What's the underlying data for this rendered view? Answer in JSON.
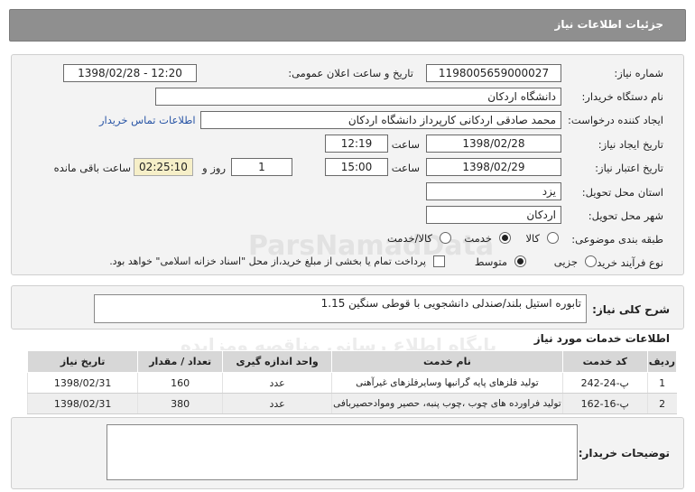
{
  "header": {
    "title": "جزئیات اطلاعات نیاز"
  },
  "form": {
    "need_number_label": "شماره نیاز:",
    "need_number": "1198005659000027",
    "announce_label": "تاریخ و ساعت اعلان عمومی:",
    "announce_value": "1398/02/28 - 12:20",
    "buyer_org_label": "نام دستگاه خریدار:",
    "buyer_org": "دانشگاه اردکان",
    "requester_label": "ایجاد کننده درخواست:",
    "requester": "محمد صادقی اردکانی کارپرداز دانشگاه اردکان",
    "contact_link": "اطلاعات تماس خریدار",
    "created_label": "تاریخ ایجاد نیاز:",
    "created_date": "1398/02/28",
    "time_label": "ساعت",
    "created_time": "12:19",
    "validity_label": "تاریخ اعتبار نیاز:",
    "validity_date": "1398/02/29",
    "validity_time": "15:00",
    "days_value": "1",
    "days_label": "روز و",
    "remaining_value": "02:25:10",
    "remaining_label": "ساعت باقی مانده",
    "province_label": "استان محل تحویل:",
    "province": "یزد",
    "city_label": "شهر محل تحویل:",
    "city": "اردکان",
    "category_label": "طبقه بندی موضوعی:",
    "category_options": [
      "کالا",
      "خدمت",
      "کالا/خدمت"
    ],
    "purchase_type_label": "نوع فرآیند خرید :",
    "purchase_options": [
      "جزیی",
      "متوسط"
    ],
    "treasury_note": "پرداخت تمام یا بخشی از مبلغ خرید،از محل \"اسناد خزانه اسلامی\" خواهد بود."
  },
  "summary": {
    "label": "شرح کلی نیاز:",
    "text": "تابوره استیل بلند/صندلی دانشجویی با قوطی سنگین 1.15"
  },
  "services": {
    "title": "اطلاعات خدمات مورد نیاز",
    "columns": [
      "ردیف",
      "کد خدمت",
      "نام خدمت",
      "واحد اندازه گیری",
      "تعداد / مقدار",
      "تاریخ نیاز"
    ],
    "rows": [
      [
        "1",
        "پ-24-242",
        "تولید فلزهای پایه گرانبها وسایرفلزهای غیرآهنی",
        "عدد",
        "160",
        "1398/02/31"
      ],
      [
        "2",
        "پ-16-162",
        "تولید فراورده های چوب ،چوب پنبه، حصیر وموادحصیربافی",
        "عدد",
        "380",
        "1398/02/31"
      ]
    ]
  },
  "buyer_notes": {
    "label": "توضیحات خریدار:"
  },
  "watermark": {
    "line1": "ParsNamadData",
    "line2": "پایگاه اطلاع رسانی مناقصه ومزایده",
    "line3": "۰۲۱-۸۸۳۴۹۶۷۰ - ۵"
  }
}
